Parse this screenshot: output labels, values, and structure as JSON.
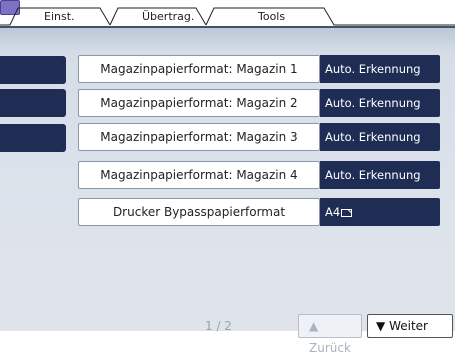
{
  "tabs": [
    {
      "label": "Einst."
    },
    {
      "label": "Übertrag."
    },
    {
      "label": "Tools"
    }
  ],
  "rows": [
    {
      "label": "Magazinpapierformat: Magazin 1",
      "value": "Auto. Erkennung"
    },
    {
      "label": "Magazinpapierformat: Magazin 2",
      "value": "Auto. Erkennung"
    },
    {
      "label": "Magazinpapierformat: Magazin 3",
      "value": "Auto. Erkennung"
    },
    {
      "label": "Magazinpapierformat: Magazin 4",
      "value": "Auto. Erkennung"
    },
    {
      "label": "Drucker Bypasspapierformat",
      "value": "A4"
    }
  ],
  "pager": {
    "text": "1 / 2"
  },
  "nav": {
    "back_label": "Zurück",
    "next_label": "Weiter"
  },
  "icons": {
    "corner": "menu-icon",
    "paper": "landscape-paper-icon",
    "up": "arrow-up-icon",
    "down": "arrow-down-icon"
  },
  "colors": {
    "value_bg": "#1f2d55",
    "panel_bg": "#dde3eb",
    "corner": "#7b72c4"
  }
}
